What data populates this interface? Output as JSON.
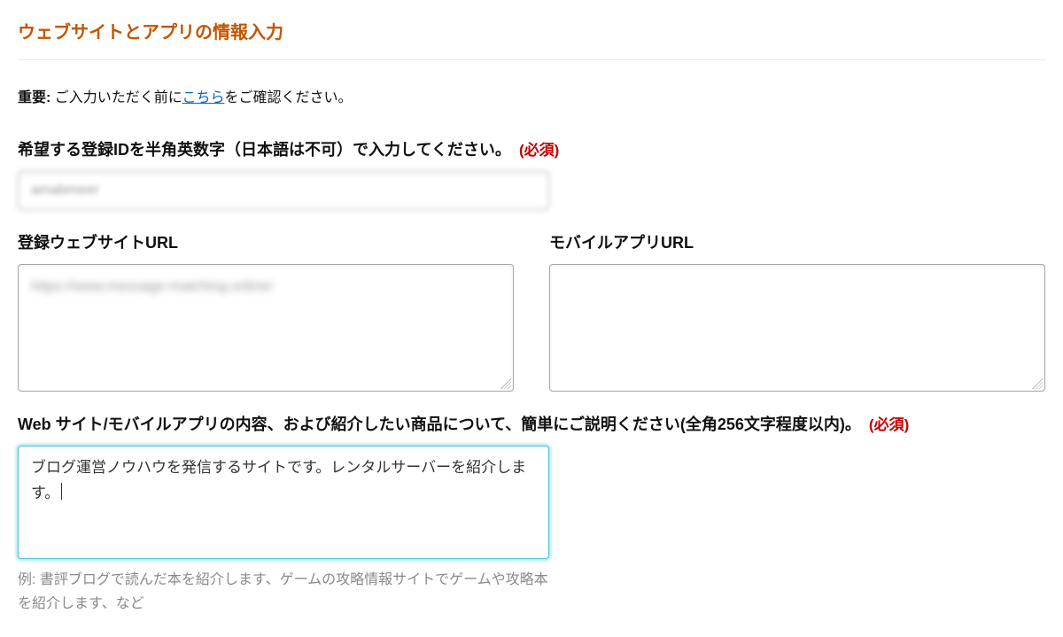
{
  "page": {
    "title": "ウェブサイトとアプリの情報入力"
  },
  "notice": {
    "label": "重要:",
    "before": " ご入力いただく前に",
    "link": "こちら",
    "after": "をご確認ください。"
  },
  "required_label": "(必須)",
  "registration_id": {
    "label": "希望する登録IDを半角英数字（日本語は不可）で入力してください。",
    "value": "amabmeer"
  },
  "website_url": {
    "label": "登録ウェブサイトURL",
    "value": "https://www.message-matching.online/"
  },
  "mobile_url": {
    "label": "モバイルアプリURL",
    "value": ""
  },
  "description": {
    "label": "Web サイト/モバイルアプリの内容、および紹介したい商品について、簡単にご説明ください(全角256文字程度以内)。",
    "value": "ブログ運営ノウハウを発信するサイトです。レンタルサーバーを紹介します。",
    "example": "例: 書評ブログで読んだ本を紹介します、ゲームの攻略情報サイトでゲームや攻略本を紹介します、など"
  }
}
